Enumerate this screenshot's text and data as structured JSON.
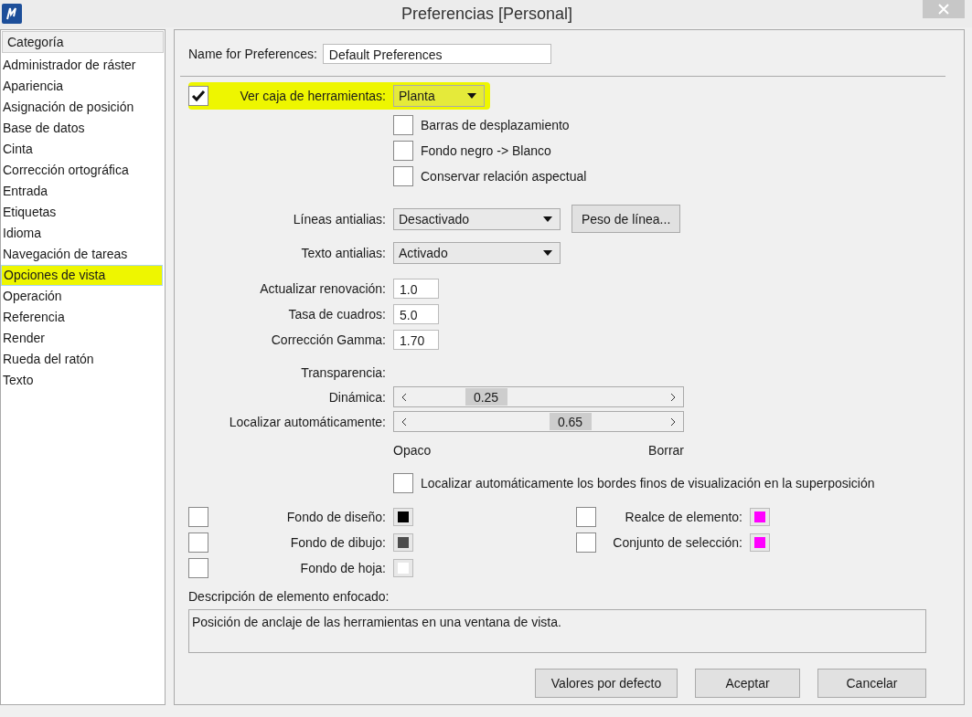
{
  "window": {
    "title": "Preferencias [Personal]"
  },
  "sidebar": {
    "header": "Categoría",
    "items": [
      {
        "label": "Administrador de ráster",
        "selected": false,
        "highlighted": false
      },
      {
        "label": "Apariencia",
        "selected": false,
        "highlighted": false
      },
      {
        "label": "Asignación de posición",
        "selected": false,
        "highlighted": false
      },
      {
        "label": "Base de datos",
        "selected": false,
        "highlighted": false
      },
      {
        "label": "Cinta",
        "selected": false,
        "highlighted": false
      },
      {
        "label": "Corrección ortográfica",
        "selected": false,
        "highlighted": false
      },
      {
        "label": "Entrada",
        "selected": false,
        "highlighted": false
      },
      {
        "label": "Etiquetas",
        "selected": false,
        "highlighted": false
      },
      {
        "label": "Idioma",
        "selected": false,
        "highlighted": false
      },
      {
        "label": "Navegación de tareas",
        "selected": false,
        "highlighted": false
      },
      {
        "label": "Opciones de vista",
        "selected": true,
        "highlighted": true
      },
      {
        "label": "Operación",
        "selected": false,
        "highlighted": false
      },
      {
        "label": "Referencia",
        "selected": false,
        "highlighted": false
      },
      {
        "label": "Render",
        "selected": false,
        "highlighted": false
      },
      {
        "label": "Rueda del ratón",
        "selected": false,
        "highlighted": false
      },
      {
        "label": "Texto",
        "selected": false,
        "highlighted": false
      }
    ]
  },
  "name_field": {
    "label": "Name for Preferences:",
    "value": "Default Preferences"
  },
  "toolbox": {
    "label": "Ver caja de herramientas:",
    "checked": true,
    "highlighted": true,
    "value": "Planta"
  },
  "view_checks": [
    {
      "label": "Barras de desplazamiento",
      "checked": false
    },
    {
      "label": "Fondo negro -> Blanco",
      "checked": false
    },
    {
      "label": "Conservar relación aspectual",
      "checked": false
    }
  ],
  "antialias": [
    {
      "label": "Líneas antialias:",
      "value": "Desactivado"
    },
    {
      "label": "Texto antialias:",
      "value": "Activado"
    }
  ],
  "line_weight_button": "Peso de línea...",
  "numbers": [
    {
      "label": "Actualizar renovación:",
      "value": "1.0"
    },
    {
      "label": "Tasa de cuadros:",
      "value": "5.0"
    },
    {
      "label": "Corrección Gamma:",
      "value": "1.70"
    }
  ],
  "transparency": {
    "label": "Transparencia:",
    "sliders": [
      {
        "label": "Dinámica:",
        "value": "0.25",
        "level": 0.25
      },
      {
        "label": "Localizar automáticamente:",
        "value": "0.65",
        "level": 0.65
      }
    ],
    "min_label": "Opaco",
    "max_label": "Borrar"
  },
  "auto_locate": {
    "label": "Localizar automáticamente los bordes finos de visualización en la superposición",
    "checked": false
  },
  "colors_left": [
    {
      "label": "Fondo de diseño:",
      "checked": false,
      "color": "#000000"
    },
    {
      "label": "Fondo de dibujo:",
      "checked": false,
      "color": "#4d4d4d"
    },
    {
      "label": "Fondo de hoja:",
      "checked": false,
      "color": "#ffffff"
    }
  ],
  "colors_right": [
    {
      "label": "Realce de elemento:",
      "checked": false,
      "color": "#ff00ff"
    },
    {
      "label": "Conjunto de selección:",
      "checked": false,
      "color": "#ff00ff"
    }
  ],
  "description": {
    "label": "Descripción de elemento enfocado:",
    "text": "Posición de anclaje de las herramientas en una ventana de vista."
  },
  "buttons": [
    "Valores por defecto",
    "Aceptar",
    "Cancelar"
  ]
}
